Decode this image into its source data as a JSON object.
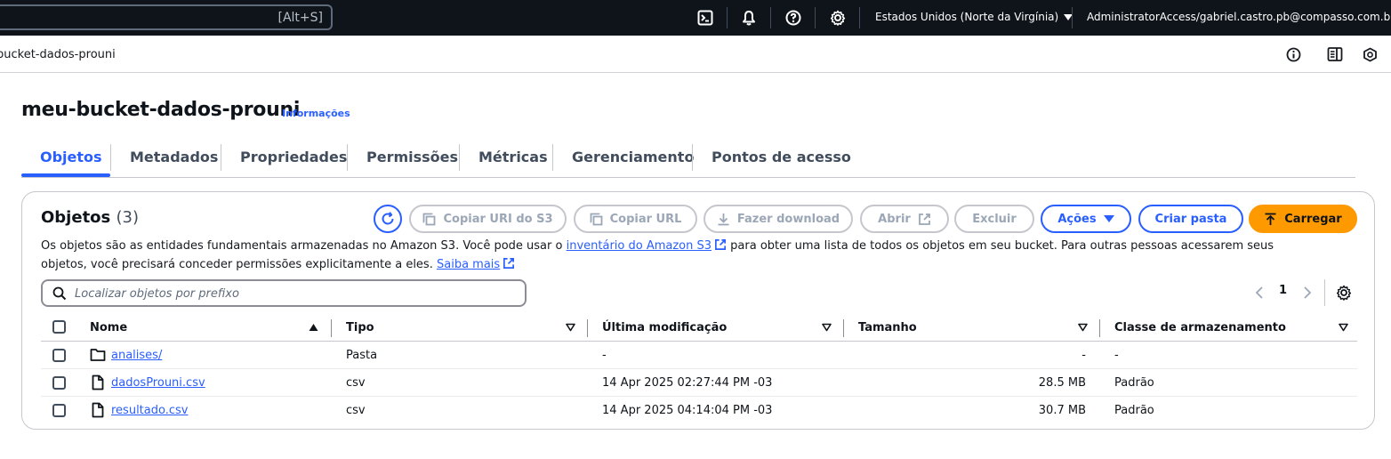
{
  "topnav": {
    "search_shortcut": "[Alt+S]",
    "region": "Estados Unidos (Norte da Virgínia)",
    "account": "AdministratorAccess/gabriel.castro.pb@compasso.com.br"
  },
  "breadcrumb": {
    "current": "bucket-dados-prouni"
  },
  "page": {
    "title": "meu-bucket-dados-prouni",
    "info_link": "Informações"
  },
  "tabs": [
    {
      "label": "Objetos"
    },
    {
      "label": "Metadados"
    },
    {
      "label": "Propriedades"
    },
    {
      "label": "Permissões"
    },
    {
      "label": "Métricas"
    },
    {
      "label": "Gerenciamento"
    },
    {
      "label": "Pontos de acesso"
    }
  ],
  "objects": {
    "title": "Objetos",
    "count": "(3)",
    "description_1": "Os objetos são as entidades fundamentais armazenadas no Amazon S3. Você pode usar o",
    "inventory_link": "inventário do Amazon S3",
    "description_2": "para obter uma lista de todos os objetos em seu bucket. Para outras pessoas acessarem seus objetos, você precisará conceder permissões explicitamente a eles.",
    "learn_more": "Saiba mais",
    "buttons": {
      "copy_uri": "Copiar URI do S3",
      "copy_url": "Copiar URL",
      "download": "Fazer download",
      "open": "Abrir",
      "delete": "Excluir",
      "actions": "Ações",
      "create_folder": "Criar pasta",
      "upload": "Carregar"
    },
    "search_placeholder": "Localizar objetos por prefixo",
    "page_number": "1",
    "columns": {
      "name": "Nome",
      "type": "Tipo",
      "last_modified": "Última modificação",
      "size": "Tamanho",
      "storage_class": "Classe de armazenamento"
    },
    "rows": [
      {
        "icon": "folder-icon",
        "name": "analises/",
        "type": "Pasta",
        "last_modified": "-",
        "size": "-",
        "storage_class": "-"
      },
      {
        "icon": "file-icon",
        "name": "dadosProuni.csv",
        "type": "csv",
        "last_modified": "14 Apr 2025 02:27:44 PM -03",
        "size": "28.5 MB",
        "storage_class": "Padrão"
      },
      {
        "icon": "file-icon",
        "name": "resultado.csv",
        "type": "csv",
        "last_modified": "14 Apr 2025 04:14:04 PM -03",
        "size": "30.7 MB",
        "storage_class": "Padrão"
      }
    ]
  },
  "colors": {
    "accent": "#295eff",
    "primary": "#ff9900",
    "nav_bg": "#0f141a"
  }
}
